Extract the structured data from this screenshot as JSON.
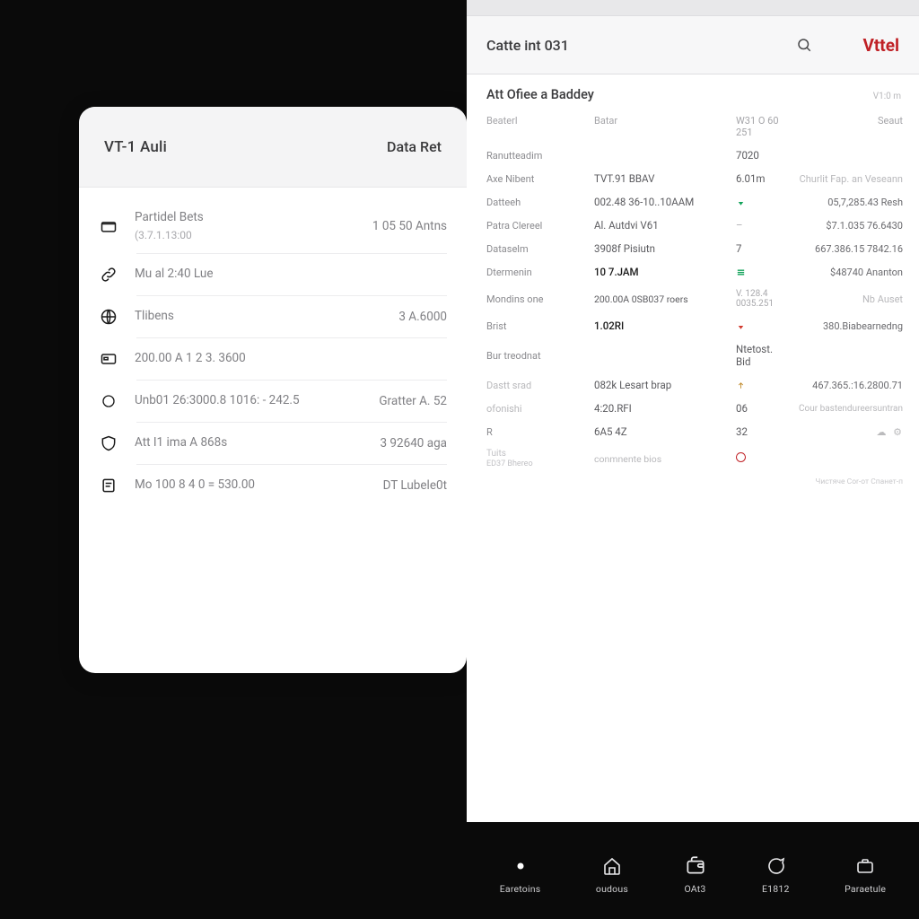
{
  "left_window": {
    "title_left": "VT-1 Auli",
    "title_right": "Data Ret",
    "rows": [
      {
        "icon": "folder",
        "label": "Partidel Bets",
        "sub": "(3.7.1.13:00",
        "value": "1 05 50 Antns"
      },
      {
        "icon": "link",
        "label": "Mu al 2:40 Lue",
        "sub": "",
        "value": ""
      },
      {
        "icon": "globe",
        "label": "Tlibens",
        "sub": "",
        "value": "3 A.6000"
      },
      {
        "icon": "card",
        "label": "200.00 A 1 2 3. 3600",
        "sub": "",
        "value": ""
      },
      {
        "icon": "circle",
        "label": "Unb01 26:3000.8 1016: - 242.5",
        "sub": "",
        "value": "Gratter A. 52"
      },
      {
        "icon": "shield",
        "label": "Att I1 ima A 868s",
        "sub": "",
        "value": "3 92640 aga"
      },
      {
        "icon": "note",
        "label": "Mo 100 8 4 0 = 530.00",
        "sub": "",
        "value": "DT Lubele0t"
      }
    ]
  },
  "right_window": {
    "header_title": "Catte int 031",
    "brand": "Vttel",
    "panel_title": "Att Ofiee a Baddey",
    "panel_meta": "V1:0 m",
    "headers": {
      "c0": "Beaterl",
      "c1": "Batar",
      "c2": "",
      "c3": "W31 O 60 251",
      "c4": "Seaut"
    },
    "rows": [
      {
        "c0": "Ranutteadim",
        "c1": "",
        "ind": "",
        "c3": "7020",
        "right": ""
      },
      {
        "c0": "Axe Nibent",
        "c1": "TVT.91     BBAV",
        "ind": "",
        "c3": "6.01m",
        "right": "Churlit Fap. an Veseann",
        "rightfaint": true
      },
      {
        "c0": "Datteeh",
        "c1": "002.48 36-10..10AAM",
        "ind": "down-green",
        "c3": "",
        "right": "05,7,285.43 Resh"
      },
      {
        "c0": "Patra Clereel",
        "c1": "Al. Autdvi V61",
        "ind": "dash",
        "c3": "",
        "right": "$7.1.035 76.6430"
      },
      {
        "c0": "Dataselm",
        "c1": "3908f Pisiutn",
        "ind": "",
        "c3": "7",
        "right": "667.386.15 7842.16"
      },
      {
        "c0": "Dtermenin",
        "c1": "10 7.JAM",
        "c1dark": true,
        "ind": "menu-green",
        "c3": "",
        "right": "$48740 Ananton"
      },
      {
        "c0": "Mondins one",
        "c1": "200.00A 0SB037 roers",
        "ind": "",
        "c3": "V. 128.4 0035.251",
        "right": "Nb Auset",
        "rightfaint": true
      },
      {
        "c0": "Brist",
        "c1": "1.02RI",
        "c1dark": true,
        "ind": "down-red",
        "c3": "",
        "right": "380.Biabearnedng"
      },
      {
        "c0": "Bur treodnat",
        "c1": "",
        "ind": "",
        "c3": "Ntetost. Bid",
        "right": ""
      },
      {
        "c0": "Dastt srad",
        "c1": "082k Lesart brap",
        "ind": "up-arrow",
        "c3": "",
        "right": "467.365.:16.2800.71",
        "c0faint": true
      },
      {
        "c0": "ofonishi",
        "c1": "4:20.RFI",
        "ind": "",
        "c3": "06",
        "right": "Cour bastendureersuntran",
        "c0faint": true,
        "rightfaint": true
      },
      {
        "c0": "R",
        "c1": "6A5 4Z",
        "ind": "",
        "c3": "32",
        "right": "miniicons"
      },
      {
        "c0": "Tuits",
        "c0sub": "ED37 Bhereo",
        "c1": "conmnente bios",
        "ind": "ring",
        "c3": "",
        "right": "",
        "c0faint": true,
        "c1faint": true
      }
    ],
    "footer_note": "Чистяче Соr-от Спанет-п"
  },
  "bottom_nav": [
    {
      "icon": "dot",
      "label": "Earetoins",
      "active": true
    },
    {
      "icon": "home",
      "label": "oudous"
    },
    {
      "icon": "wallet",
      "label": "OAt3"
    },
    {
      "icon": "chat",
      "label": "E1812"
    },
    {
      "icon": "portfolio",
      "label": "Paraetule"
    }
  ]
}
